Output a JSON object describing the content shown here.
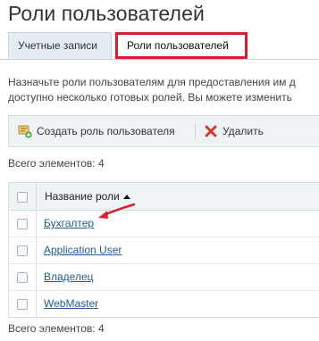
{
  "page": {
    "title": "Роли пользователей"
  },
  "tabs": [
    {
      "label": "Учетные записи"
    },
    {
      "label": "Роли пользователей"
    }
  ],
  "description": {
    "line1": "Назначьте роли пользователям для предоставления им д",
    "line2": "доступно несколько готовых ролей. Вы можете изменить"
  },
  "toolbar": {
    "create_label": "Создать роль пользователя",
    "delete_label": "Удалить"
  },
  "counts": {
    "top": "Всего элементов: 4",
    "bottom": "Всего элементов: 4"
  },
  "table": {
    "header": "Название роли",
    "rows": [
      {
        "name": "Бухгалтер"
      },
      {
        "name": "Application User"
      },
      {
        "name": "Владелец"
      },
      {
        "name": "WebMaster"
      }
    ]
  },
  "colors": {
    "highlight_red": "#d9202a",
    "link_blue": "#1f5d96"
  }
}
